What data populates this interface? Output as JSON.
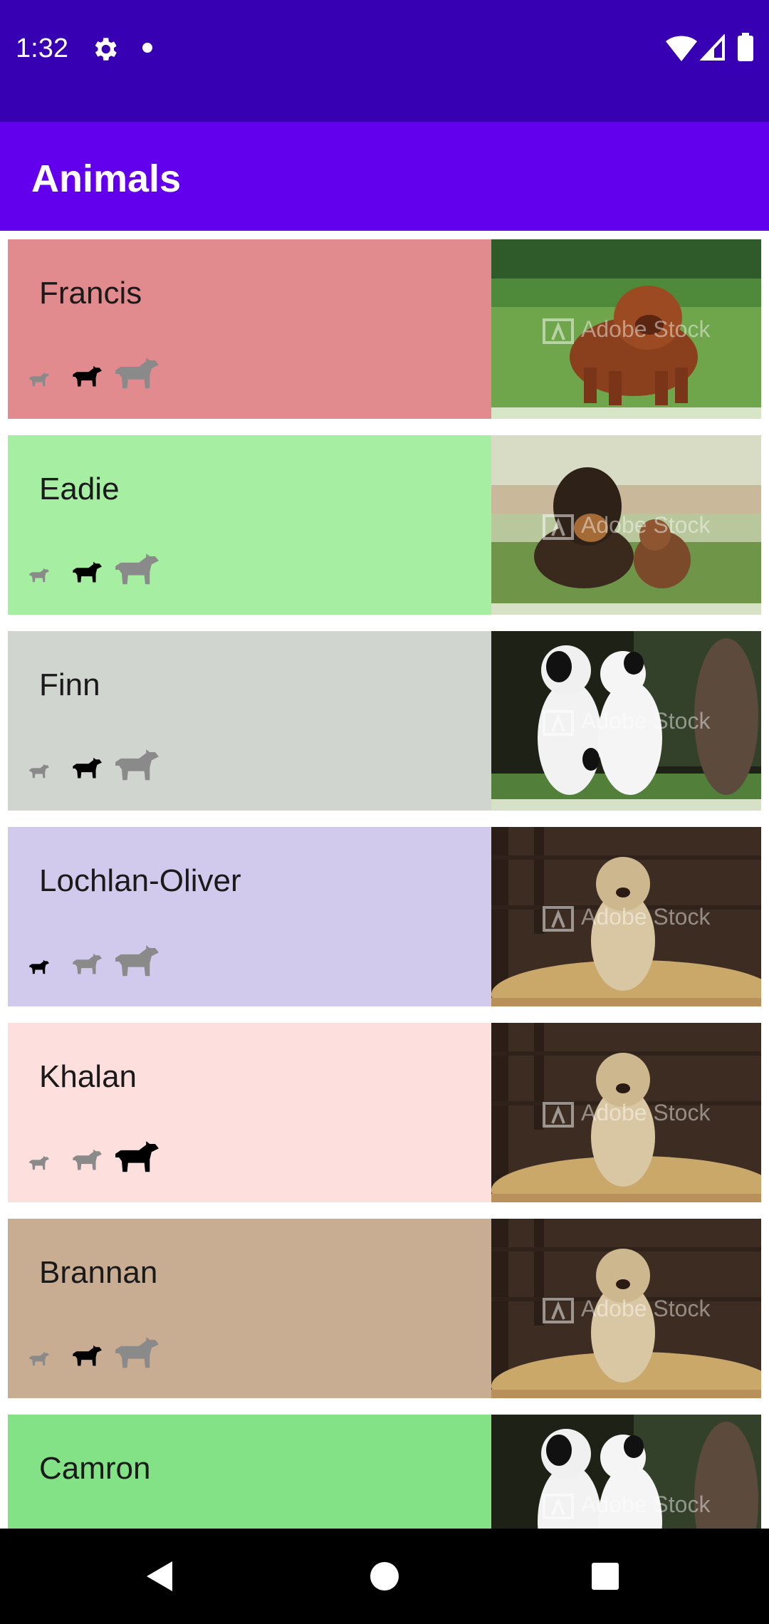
{
  "status_bar": {
    "time": "1:32",
    "icons": [
      "gear-icon",
      "dot-icon",
      "wifi-icon",
      "signal-icon",
      "battery-icon"
    ]
  },
  "app_bar": {
    "title": "Animals"
  },
  "colors": {
    "status_bar": "#3700b3",
    "app_bar": "#6200ee",
    "size_active": "#000000",
    "size_inactive": "#8a8a8a"
  },
  "watermark_text": "Adobe Stock",
  "animals": [
    {
      "name": "Francis",
      "color": "#e28b8e",
      "size": "medium",
      "photo": "brown-chow-chow"
    },
    {
      "name": "Eadie",
      "color": "#a6efa2",
      "size": "medium",
      "photo": "two-mastiff-puppies"
    },
    {
      "name": "Finn",
      "color": "#d0d5cf",
      "size": "medium",
      "photo": "two-great-dane-puppies"
    },
    {
      "name": "Lochlan-Oliver",
      "color": "#d1caec",
      "size": "small",
      "photo": "shepherd-dog-on-hay"
    },
    {
      "name": "Khalan",
      "color": "#fde0de",
      "size": "large",
      "photo": "shepherd-dog-on-hay"
    },
    {
      "name": "Brannan",
      "color": "#c9ad93",
      "size": "medium",
      "photo": "shepherd-dog-on-hay"
    },
    {
      "name": "Camron",
      "color": "#83e186",
      "size": "",
      "photo": "two-great-dane-puppies"
    }
  ],
  "nav_bar": {
    "buttons": [
      "back-icon",
      "home-icon",
      "recents-icon"
    ]
  }
}
